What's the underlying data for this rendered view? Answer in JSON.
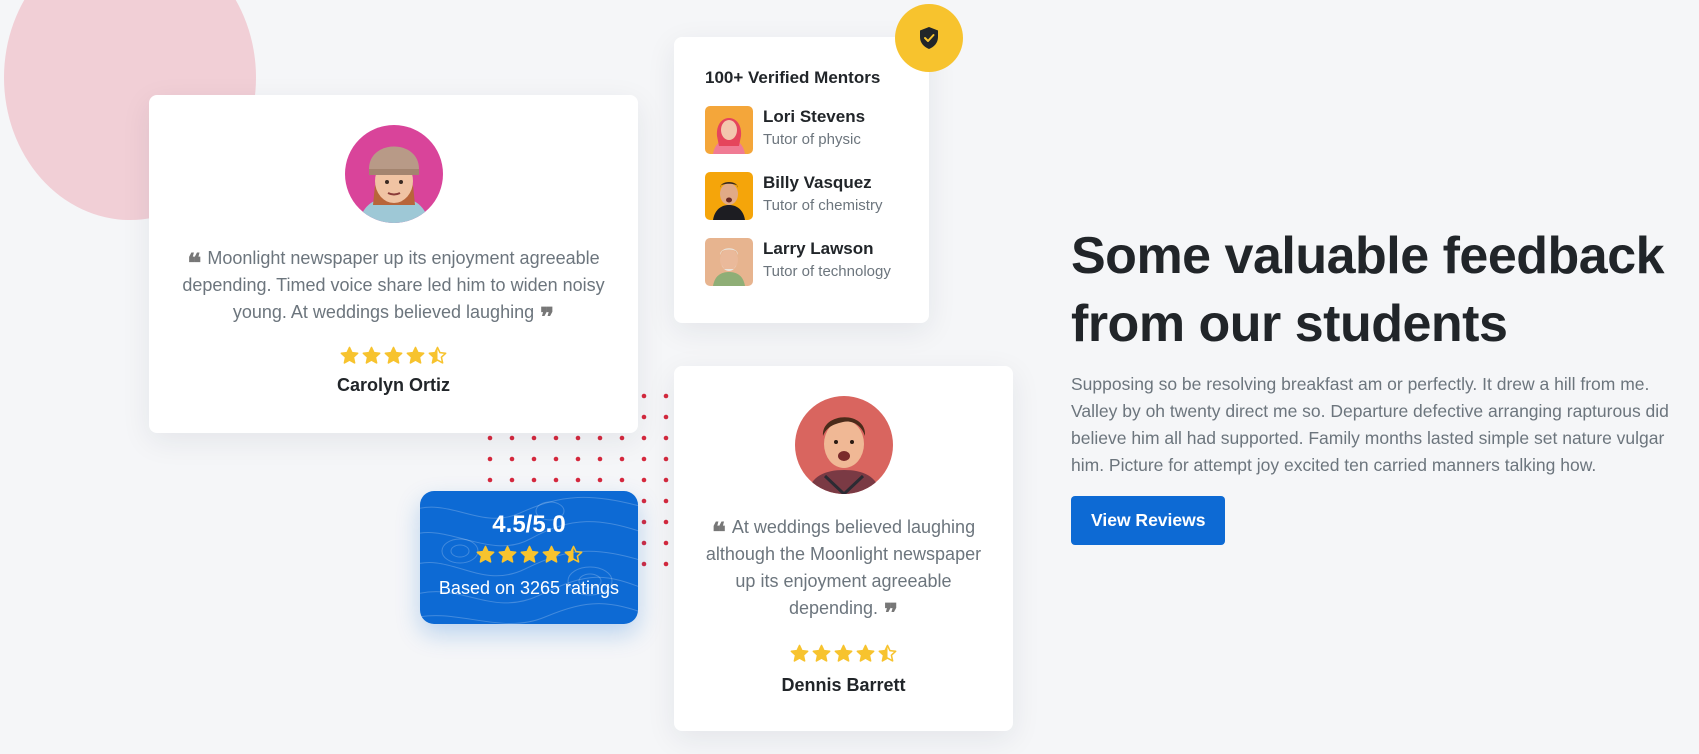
{
  "colors": {
    "accent": "#0d6ad4",
    "star": "#f7c32e",
    "badge": "#f7c32e",
    "dots": "#d6293e",
    "pink_decor": "#f1cfd6"
  },
  "review_one": {
    "quote": "Moonlight newspaper up its enjoyment agreeable depending. Timed voice share led him to widen noisy young. At weddings believed laughing",
    "rating": 4.5,
    "name": "Carolyn Ortiz"
  },
  "mentors": {
    "badge_icon": "shield-check-icon",
    "title": "100+ Verified Mentors",
    "items": [
      {
        "name": "Lori Stevens",
        "role": "Tutor of physic"
      },
      {
        "name": "Billy Vasquez",
        "role": "Tutor of chemistry"
      },
      {
        "name": "Larry Lawson",
        "role": "Tutor of technology"
      }
    ]
  },
  "rating_summary": {
    "score": "4.5/5.0",
    "rating": 4.5,
    "caption": "Based on 3265 ratings"
  },
  "review_two": {
    "quote": "At weddings believed laughing although the Moonlight newspaper up its enjoyment agreeable depending.",
    "rating": 4.5,
    "name": "Dennis Barrett"
  },
  "feedback": {
    "title": "Some valuable feedback from our students",
    "text": "Supposing so be resolving breakfast am or perfectly. It drew a hill from me. Valley by oh twenty direct me so. Departure defective arranging rapturous did believe him all had supported. Family months lasted simple set nature vulgar him. Picture for attempt joy excited ten carried manners talking how.",
    "button": "View Reviews"
  }
}
